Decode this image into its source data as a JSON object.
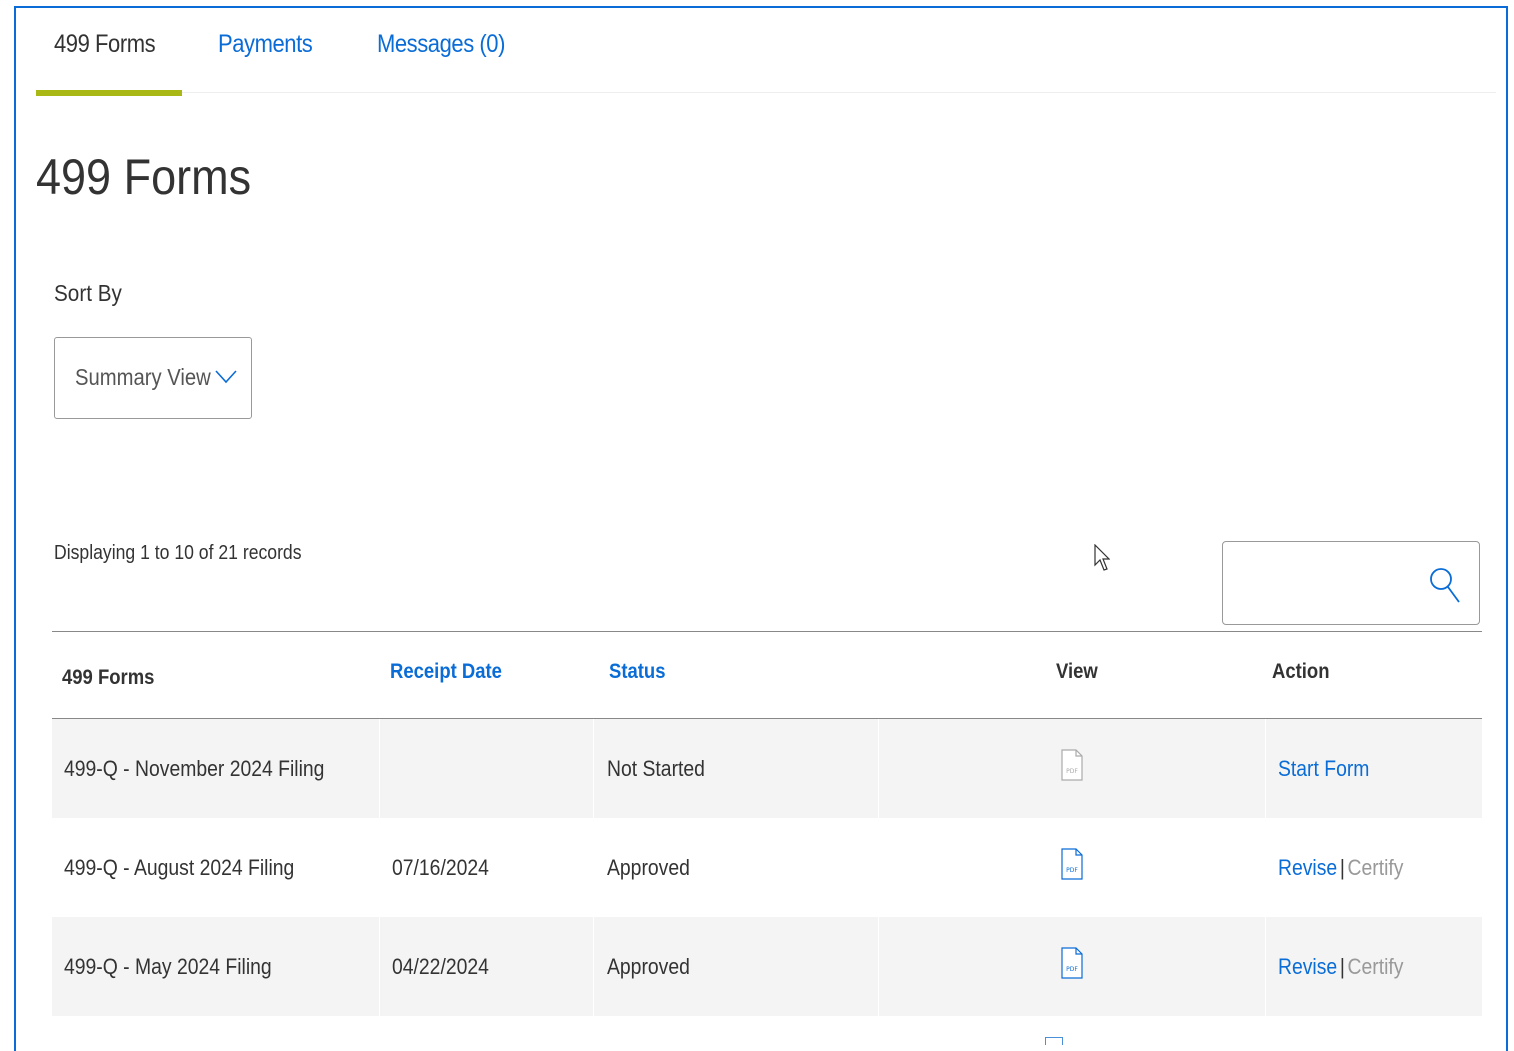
{
  "tabs": [
    {
      "label": "499 Forms",
      "active": true
    },
    {
      "label": "Payments",
      "active": false
    },
    {
      "label": "Messages (0)",
      "active": false
    }
  ],
  "page_title": "499 Forms",
  "sort": {
    "label": "Sort By",
    "selected": "Summary View",
    "icon": "chevron-down-icon"
  },
  "records_info": "Displaying 1 to 10 of 21 records",
  "search": {
    "placeholder": "",
    "icon": "search-icon"
  },
  "table": {
    "headers": [
      "499 Forms",
      "Receipt Date",
      "Status",
      "View",
      "Action"
    ],
    "rows": [
      {
        "form": "499-Q - November 2024 Filing",
        "receipt_date": "",
        "status": "Not Started",
        "view_icon": "pdf-icon-disabled",
        "actions": [
          "Start Form"
        ]
      },
      {
        "form": "499-Q - August 2024 Filing",
        "receipt_date": "07/16/2024",
        "status": "Approved",
        "view_icon": "pdf-icon",
        "actions": [
          "Revise",
          "Certify"
        ]
      },
      {
        "form": "499-Q - May 2024 Filing",
        "receipt_date": "04/22/2024",
        "status": "Approved",
        "view_icon": "pdf-icon",
        "actions": [
          "Revise",
          "Certify"
        ]
      }
    ]
  },
  "colors": {
    "accent": "#0a6cd6",
    "tab_underline": "#aab816",
    "row_shade": "#f4f4f4",
    "muted": "#999999"
  }
}
